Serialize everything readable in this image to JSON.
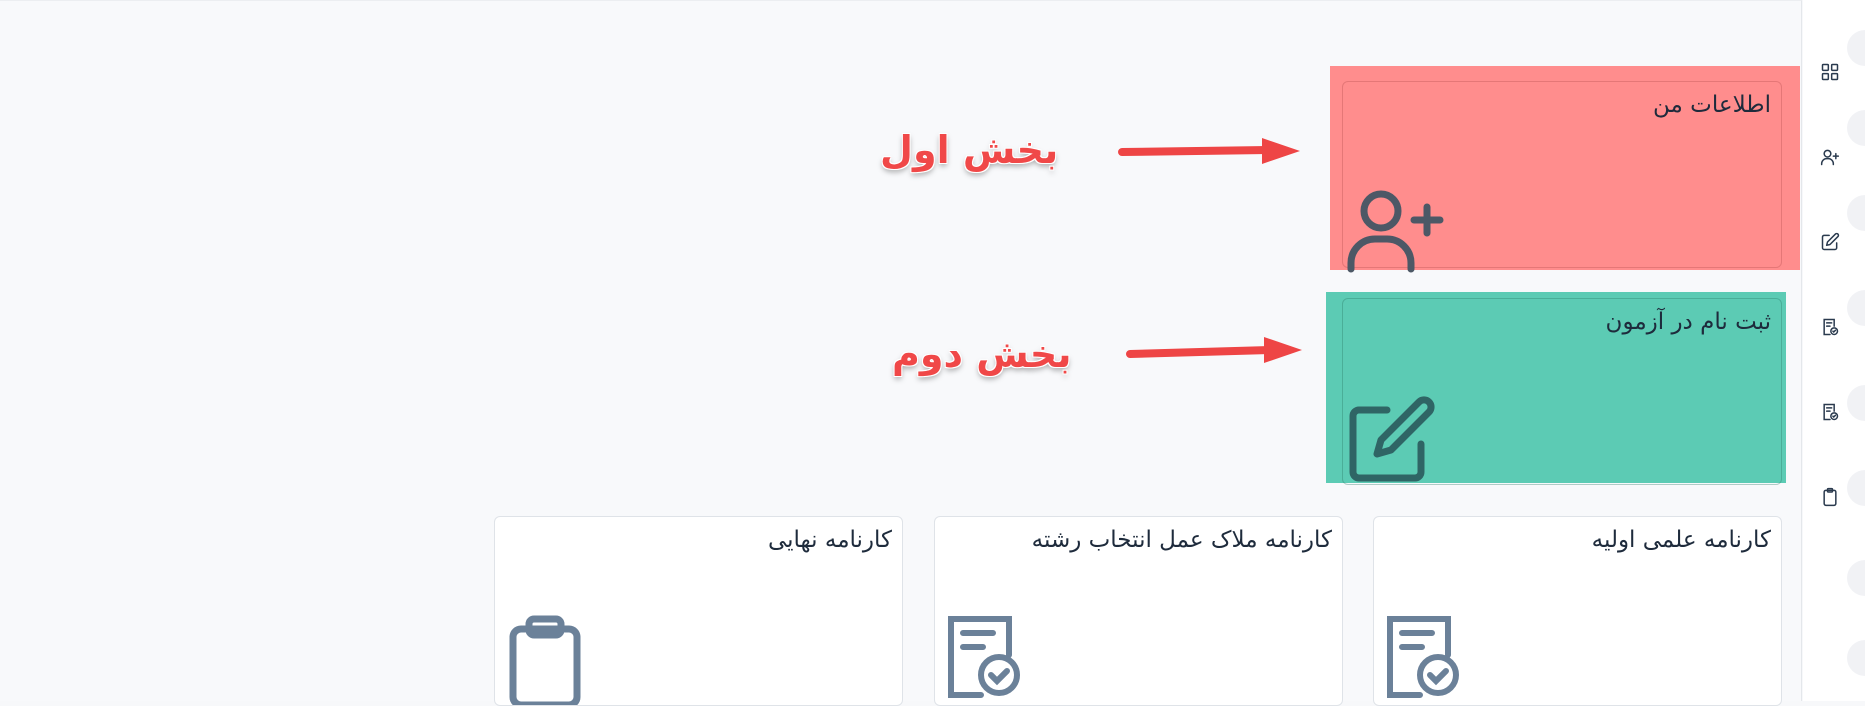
{
  "cards": {
    "my_info": {
      "title": "اطلاعات من",
      "icon": "user-plus-icon"
    },
    "exam_registration": {
      "title": "ثبت نام در آزمون",
      "icon": "edit-icon"
    },
    "initial_scorecard": {
      "title": "کارنامه علمی اولیه",
      "icon": "document-check-icon"
    },
    "major_selection_scorecard": {
      "title": "کارنامه ملاک عمل انتخاب رشته",
      "icon": "document-check-icon"
    },
    "final_scorecard": {
      "title": "کارنامه نهایی",
      "icon": "clipboard-icon"
    }
  },
  "annotations": {
    "first": "بخش اول",
    "second": "بخش دوم"
  },
  "sidebar": {
    "items": [
      {
        "icon": "dashboard-grid-icon"
      },
      {
        "icon": "user-plus-icon"
      },
      {
        "icon": "edit-icon"
      },
      {
        "icon": "document-check-icon"
      },
      {
        "icon": "document-check-icon"
      },
      {
        "icon": "clipboard-icon"
      }
    ]
  },
  "colors": {
    "highlight_first": "#ff8a8a",
    "highlight_second": "#4fc8ad",
    "annotation_red": "#f04848",
    "icon_gray": "#6b8199",
    "icon_dark_teal": "#2f5e62"
  }
}
